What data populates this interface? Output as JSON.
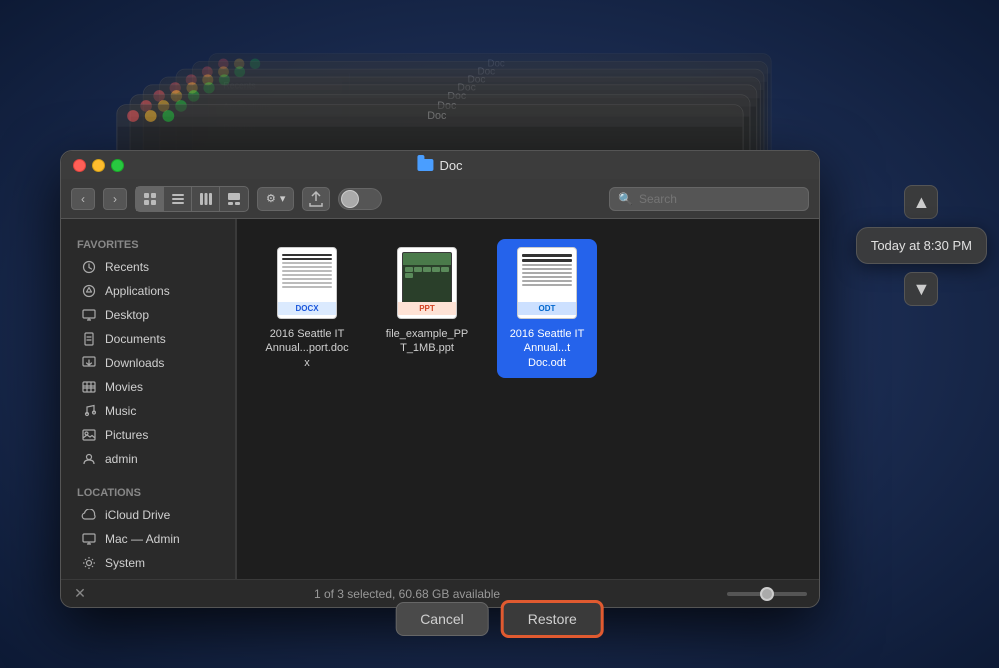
{
  "background_windows": [
    {
      "title": "Doc"
    },
    {
      "title": "Doc"
    },
    {
      "title": "Doc"
    },
    {
      "title": "Doc"
    },
    {
      "title": "Doc"
    },
    {
      "title": "Doc"
    },
    {
      "title": "Doc"
    }
  ],
  "window": {
    "title": "Doc",
    "title_icon": "folder-icon"
  },
  "toolbar": {
    "back_label": "‹",
    "forward_label": "›",
    "view_icon_grid": "⊞",
    "view_icon_list": "☰",
    "view_icon_columns": "⋮⋮",
    "view_icon_gallery": "⊟",
    "action_icon": "⚙",
    "share_icon": "↑",
    "toggle_label": "",
    "search_placeholder": "Search"
  },
  "sidebar": {
    "favorites_label": "Favorites",
    "locations_label": "Locations",
    "items": [
      {
        "label": "Recents",
        "icon": "🕐"
      },
      {
        "label": "Applications",
        "icon": "🔲"
      },
      {
        "label": "Desktop",
        "icon": "🖥"
      },
      {
        "label": "Documents",
        "icon": "📄"
      },
      {
        "label": "Downloads",
        "icon": "📥"
      },
      {
        "label": "Movies",
        "icon": "🎬"
      },
      {
        "label": "Music",
        "icon": "🎵"
      },
      {
        "label": "Pictures",
        "icon": "📷"
      },
      {
        "label": "admin",
        "icon": "🏠"
      }
    ],
    "location_items": [
      {
        "label": "iCloud Drive",
        "icon": "☁"
      },
      {
        "label": "Mac — Admin",
        "icon": "🖥"
      },
      {
        "label": "System",
        "icon": "⚙"
      }
    ]
  },
  "files": [
    {
      "name": "2016 Seattle IT Annual...port.docx",
      "type": "docx",
      "selected": false
    },
    {
      "name": "file_example_PPT_1MB.ppt",
      "type": "ppt",
      "selected": false
    },
    {
      "name": "2016 Seattle IT Annual...t Doc.odt",
      "type": "odt",
      "selected": true
    }
  ],
  "status_bar": {
    "text": "1 of 3 selected, 60.68 GB available"
  },
  "notification": {
    "time_text": "Today at 8:30 PM"
  },
  "buttons": {
    "cancel_label": "Cancel",
    "restore_label": "Restore"
  }
}
